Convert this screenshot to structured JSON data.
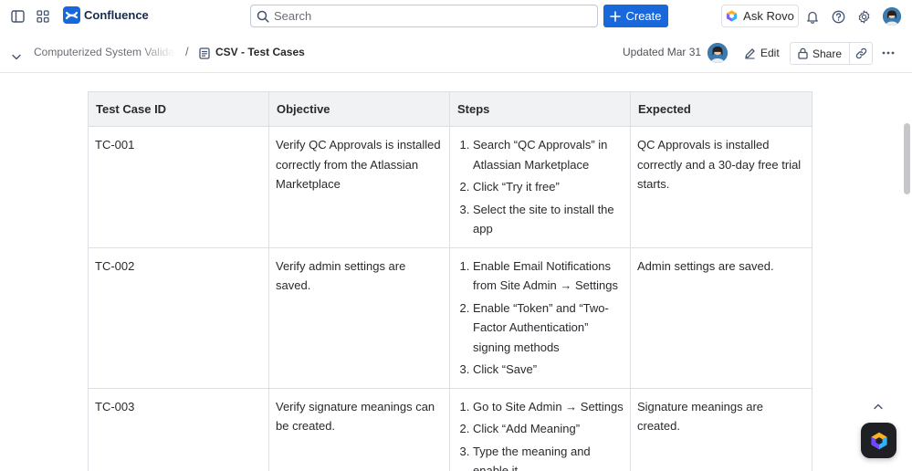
{
  "app": {
    "name": "Confluence",
    "accent_color": "#1868db"
  },
  "topnav": {
    "search_placeholder": "Search",
    "create_label": "Create",
    "ask_rovo_label": "Ask Rovo",
    "icons": [
      "sidebar-toggle-icon",
      "app-switcher-icon",
      "confluence-logo-icon",
      "search-icon",
      "plus-icon",
      "rovo-icon",
      "notifications-bell-icon",
      "help-icon",
      "settings-gear-icon",
      "user-avatar"
    ]
  },
  "page_header": {
    "breadcrumb_parent": "Computerized System Validation",
    "breadcrumb_separator": "/",
    "current_page": "CSV - Test Cases",
    "updated": "Updated Mar 31",
    "edit_label": "Edit",
    "share_label": "Share"
  },
  "table": {
    "headers": [
      "Test Case ID",
      "Objective",
      "Steps",
      "Expected"
    ],
    "rows": [
      {
        "id": "TC-001",
        "objective": "Verify QC Approvals is installed correctly from the Atlassian Marketplace",
        "steps": [
          "Search “QC Approvals” in Atlassian Marketplace",
          "Click “Try it free”",
          "Select the site to install the app"
        ],
        "expected": "QC Approvals is installed correctly and a 30-day free trial starts."
      },
      {
        "id": "TC-002",
        "objective": "Verify admin settings are saved.",
        "steps": [
          "Enable Email Notifications from Site Admin → Settings",
          "Enable “Token” and “Two-Factor Authentication” signing methods",
          "Click “Save”"
        ],
        "expected": "Admin settings are saved."
      },
      {
        "id": "TC-003",
        "objective": "Verify signature meanings can be created.",
        "steps": [
          "Go to Site Admin → Settings",
          "Click “Add Meaning”",
          "Type the meaning and enable it"
        ],
        "expected": "Signature meanings are created."
      }
    ]
  }
}
